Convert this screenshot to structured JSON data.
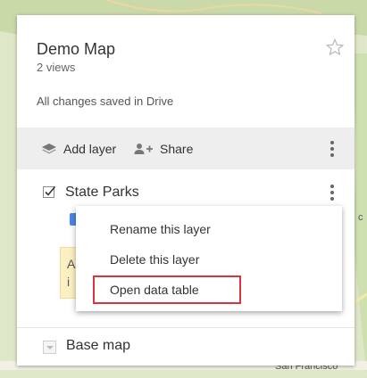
{
  "map": {
    "city_label": "San Francisco",
    "edge_label": "c"
  },
  "panel": {
    "title": "Demo Map",
    "views": "2 views",
    "saved_status": "All changes saved in Drive",
    "toolbar": {
      "add_layer_label": "Add layer",
      "share_label": "Share"
    },
    "layer": {
      "name": "State Parks",
      "checked": true
    },
    "base_map": {
      "label": "Base map"
    }
  },
  "layer_menu": {
    "items": [
      {
        "label": "Rename this layer"
      },
      {
        "label": "Delete this layer"
      },
      {
        "label": "Open data table",
        "highlighted": true
      }
    ]
  },
  "colors": {
    "map_land": "#dfe7c9",
    "toolbar_bg": "#eeeeee",
    "highlight_border": "#d9343b",
    "checkbox_blue": "#4a86e8"
  },
  "behind_text": {
    "line1": "A",
    "line2": "i"
  }
}
